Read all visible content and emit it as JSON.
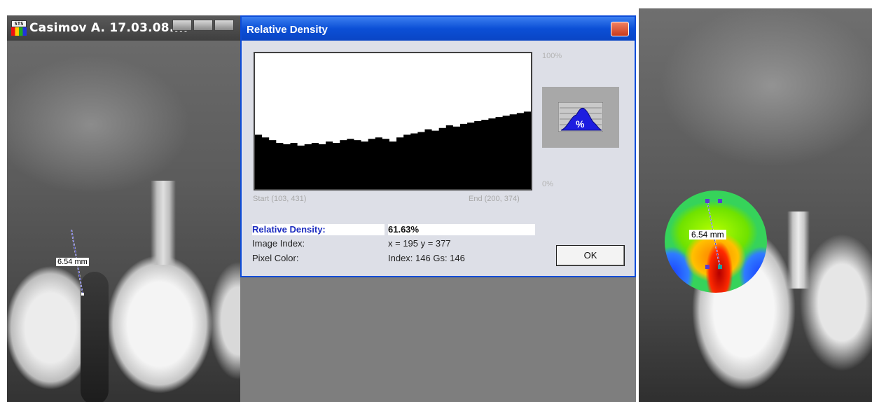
{
  "left_window": {
    "title": "Casimov A. 17.03.08....",
    "measurement_label": "6.54 mm",
    "app_icon_text": "STS"
  },
  "dialog": {
    "title": "Relative Density",
    "chart_data": {
      "type": "area",
      "title": "",
      "y_top_label": "100%",
      "y_bottom_label": "0%",
      "start_label": "Start (103, 431)",
      "end_label": "End (200, 374)",
      "x": [
        0,
        1,
        2,
        3,
        4,
        5,
        6,
        7,
        8,
        9,
        10,
        11,
        12,
        13,
        14,
        15,
        16,
        17,
        18,
        19,
        20,
        21,
        22,
        23,
        24,
        25,
        26,
        27,
        28,
        29,
        30,
        31,
        32,
        33,
        34,
        35,
        36,
        37,
        38,
        39
      ],
      "values": [
        40,
        38,
        36,
        34,
        33,
        34,
        32,
        33,
        34,
        33,
        35,
        34,
        36,
        37,
        36,
        35,
        37,
        38,
        37,
        35,
        38,
        40,
        41,
        42,
        44,
        43,
        45,
        47,
        46,
        48,
        49,
        50,
        51,
        52,
        53,
        54,
        55,
        56,
        57,
        58
      ],
      "ylim": [
        0,
        100
      ]
    },
    "relative_density_label": "Relative Density:",
    "relative_density_value": "61.63%",
    "image_index_label": "Image Index:",
    "image_index_value": "x = 195  y = 377",
    "pixel_color_label": "Pixel Color:",
    "pixel_color_value": "Index: 146  Gs: 146",
    "ok_label": "OK",
    "toggle_icon_text": "%"
  },
  "right_window": {
    "measurement_label": "6.54 mm"
  }
}
